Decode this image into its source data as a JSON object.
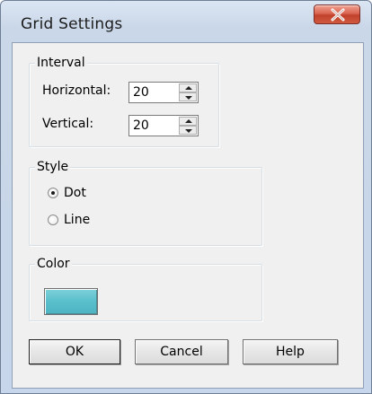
{
  "window": {
    "title": "Grid Settings"
  },
  "interval": {
    "legend": "Interval",
    "horizontal_label": "Horizontal:",
    "horizontal_value": "20",
    "vertical_label": "Vertical:",
    "vertical_value": "20"
  },
  "style": {
    "legend": "Style",
    "options": [
      {
        "label": "Dot",
        "selected": true
      },
      {
        "label": "Line",
        "selected": false
      }
    ]
  },
  "color": {
    "legend": "Color",
    "swatch_color": "#5cc0cc"
  },
  "buttons": {
    "ok": "OK",
    "cancel": "Cancel",
    "help": "Help"
  },
  "theme": {
    "close_button_color": "#c9452f"
  }
}
